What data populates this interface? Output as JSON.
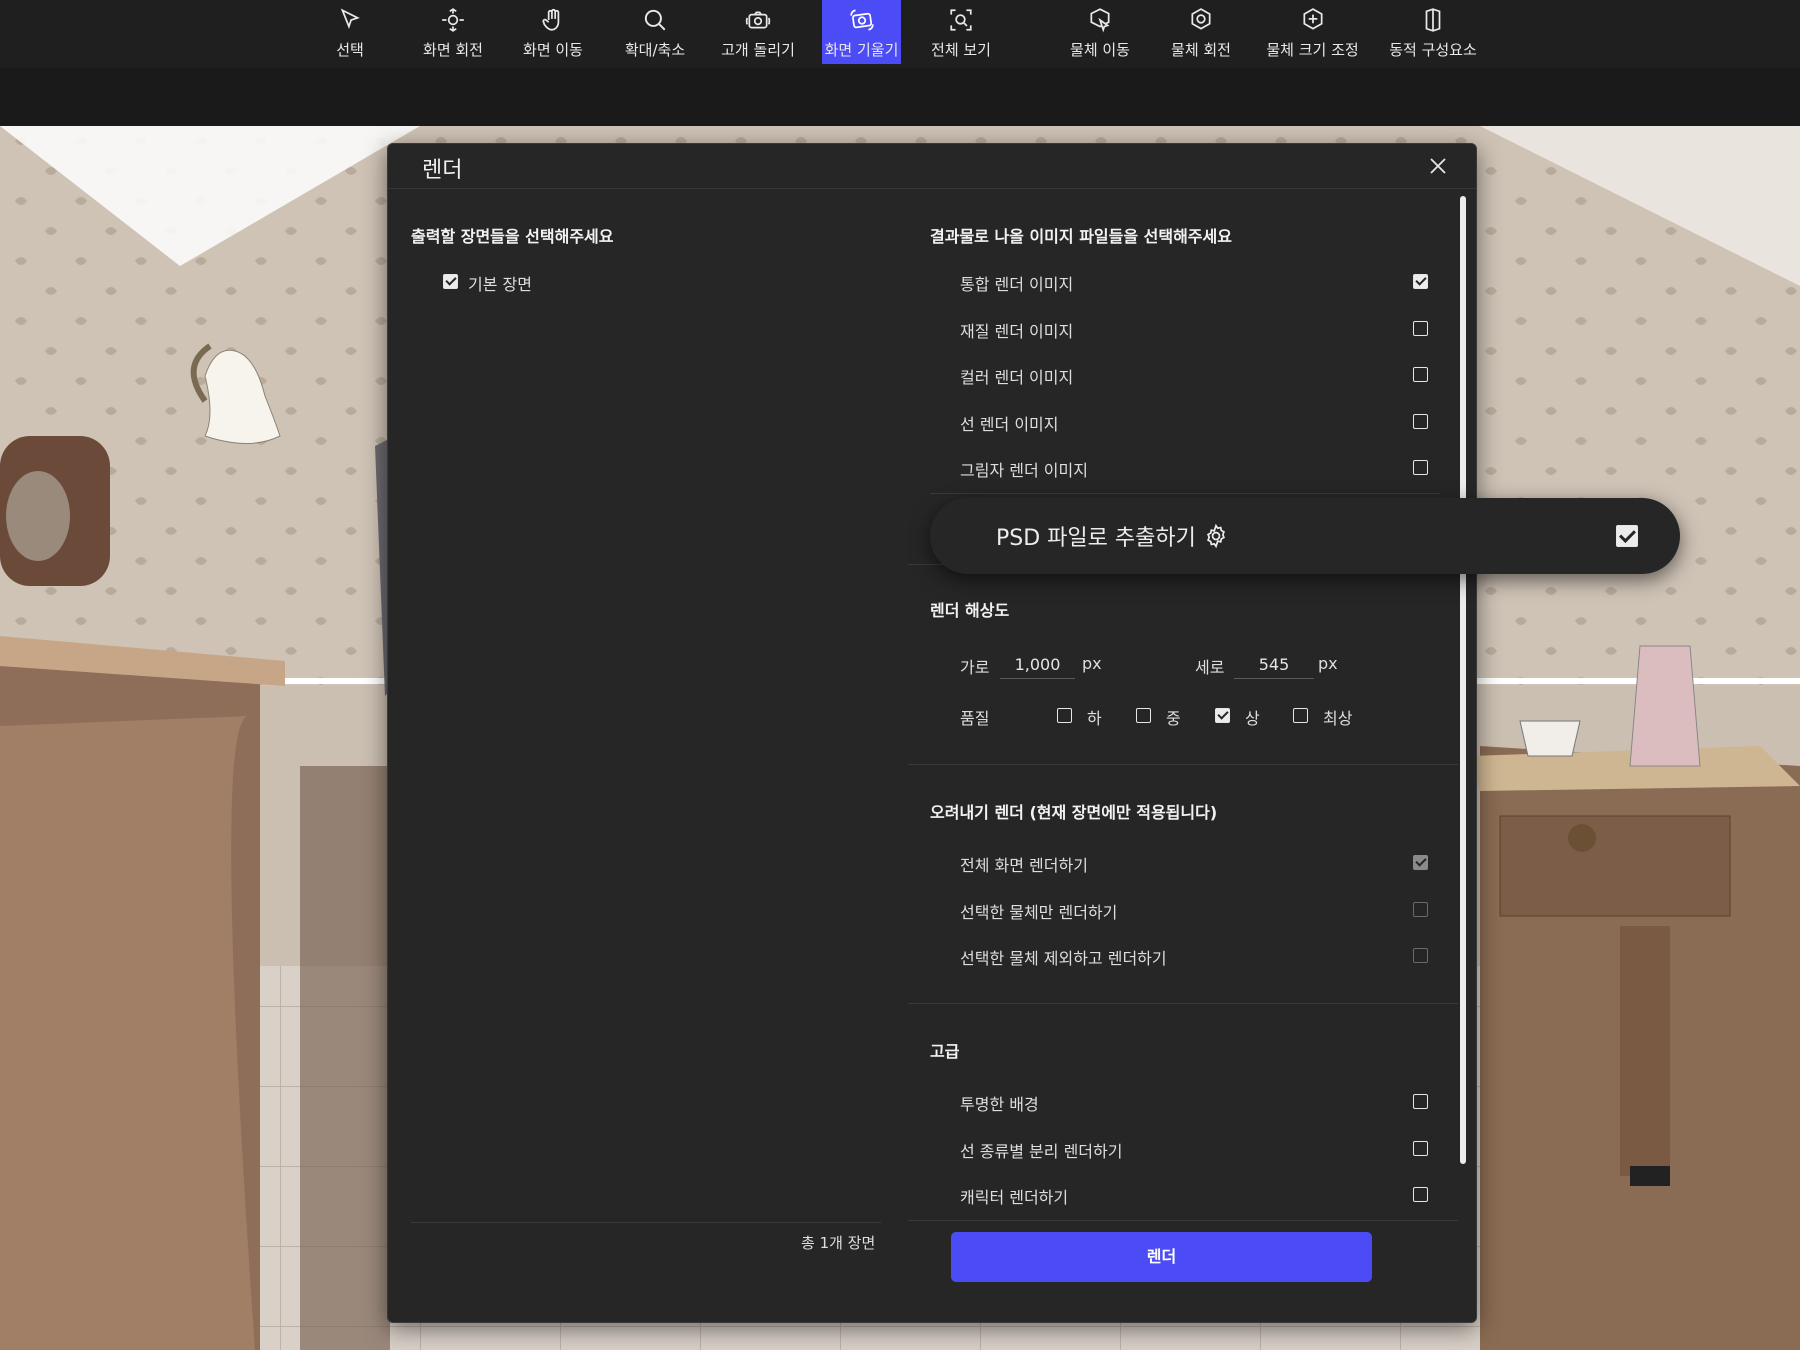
{
  "toolbar": {
    "tools": [
      {
        "label": "선택",
        "icon": "cursor-icon"
      },
      {
        "label": "화면 회전",
        "icon": "rotate-view-icon"
      },
      {
        "label": "화면 이동",
        "icon": "hand-icon"
      },
      {
        "label": "확대/축소",
        "icon": "zoom-icon"
      },
      {
        "label": "고개 돌리기",
        "icon": "camera-turn-icon"
      },
      {
        "label": "화면 기울기",
        "icon": "camera-tilt-icon",
        "active": true
      },
      {
        "label": "전체 보기",
        "icon": "fit-view-icon"
      },
      {
        "label": "물체 이동",
        "icon": "object-move-icon"
      },
      {
        "label": "물체 회전",
        "icon": "object-rotate-icon"
      },
      {
        "label": "물체 크기 조정",
        "icon": "object-scale-icon"
      },
      {
        "label": "동적 구성요소",
        "icon": "dynamic-component-icon"
      }
    ],
    "active_color": "#4b4cf5"
  },
  "dialog": {
    "title": "렌더",
    "left": {
      "section_title": "출력할 장면들을 선택해주세요",
      "scenes": [
        {
          "label": "기본 장면",
          "checked": true
        }
      ],
      "footer_count": "총 1개 장면"
    },
    "output": {
      "section_title": "결과물로 나올 이미지 파일들을 선택해주세요",
      "items": [
        {
          "label": "통합 렌더 이미지",
          "checked": true
        },
        {
          "label": "재질 렌더 이미지",
          "checked": false
        },
        {
          "label": "컬러 렌더 이미지",
          "checked": false
        },
        {
          "label": "선 렌더 이미지",
          "checked": false
        },
        {
          "label": "그림자 렌더 이미지",
          "checked": false
        }
      ]
    },
    "psd": {
      "label": "PSD 파일로 추출하기",
      "checked": true
    },
    "resolution": {
      "section_title": "렌더 해상도",
      "width_label": "가로",
      "width_value": "1,000",
      "width_unit": "px",
      "height_label": "세로",
      "height_value": "545",
      "height_unit": "px",
      "quality_label": "품질",
      "quality_options": [
        {
          "label": "하",
          "checked": false
        },
        {
          "label": "중",
          "checked": false
        },
        {
          "label": "상",
          "checked": true
        },
        {
          "label": "최상",
          "checked": false
        }
      ]
    },
    "crop": {
      "section_title": "오려내기 렌더 (현재 장면에만 적용됩니다)",
      "items": [
        {
          "label": "전체 화면 렌더하기",
          "checked": true
        },
        {
          "label": "선택한 물체만 렌더하기",
          "checked": false
        },
        {
          "label": "선택한 물체 제외하고 렌더하기",
          "checked": false
        }
      ]
    },
    "advanced": {
      "section_title": "고급",
      "items": [
        {
          "label": "투명한 배경",
          "checked": false
        },
        {
          "label": "선 종류별 분리 렌더하기",
          "checked": false
        },
        {
          "label": "캐릭터 렌더하기",
          "checked": false
        }
      ]
    },
    "render_button": "렌더"
  }
}
